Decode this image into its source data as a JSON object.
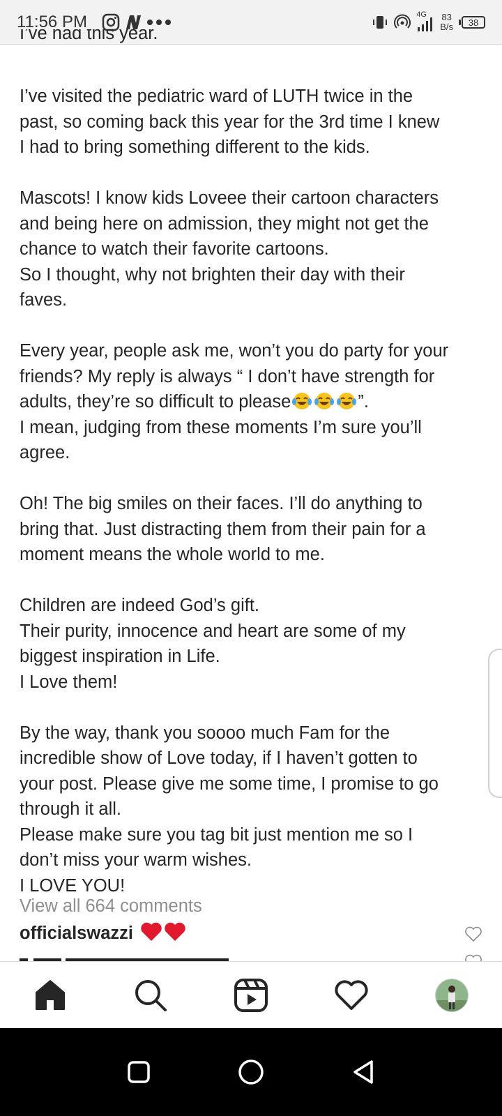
{
  "status_bar": {
    "time": "11:56 PM",
    "left_icons": [
      "instagram-icon",
      "nairaland-icon",
      "more-dots-icon"
    ],
    "network": "4G",
    "speed_value": "83",
    "speed_unit": "B/s",
    "battery": "38"
  },
  "caption": {
    "lines": [
      "I’ve had this year.",
      "",
      "I’ve visited the pediatric ward of LUTH twice in the",
      "past, so coming back this year for the 3rd time I knew",
      "I had to bring something different to the kids.",
      "",
      "Mascots! I know kids Loveee their cartoon characters",
      "and being here on admission, they might not get the",
      "chance to watch their favorite cartoons.",
      "So I thought, why not brighten their day with their",
      "faves.",
      "",
      "Every year, people ask me, won’t you do party for your",
      "friends? My reply is always “ I don’t have strength for",
      "adults, they’re so difficult to please",
      "I mean, judging from these moments I’m sure you’ll",
      "agree.",
      "",
      "Oh! The big smiles on their faces. I’ll do anything to",
      "bring that. Just distracting them from their pain for a",
      "moment means the whole world to me.",
      "",
      "Children are indeed God’s gift.",
      "Their purity, innocence and heart are some of my",
      "biggest inspiration in Life.",
      "I Love them!",
      "",
      "By the way, thank you soooo much Fam for the",
      "incredible show of Love today, if I haven’t gotten to",
      "your post. Please give me some time, I promise to go",
      "through it all.",
      "Please make sure you tag bit just mention me so I",
      "don’t miss your warm wishes.",
      "I LOVE YOU!"
    ],
    "emoji_line_suffix": "”."
  },
  "comments": {
    "view_all": "View all 664 comments",
    "items": [
      {
        "username": "officialswazzi",
        "emoji": "red-hearts"
      }
    ]
  },
  "bottom_nav": [
    "home-icon",
    "search-icon",
    "reels-icon",
    "activity-heart-icon",
    "profile-avatar"
  ],
  "android_nav": [
    "recents-button",
    "home-button",
    "back-button"
  ]
}
